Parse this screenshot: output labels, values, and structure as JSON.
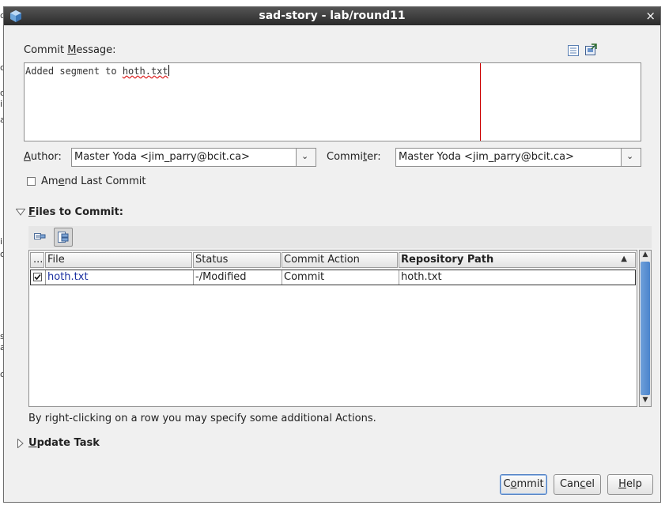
{
  "window": {
    "title": "sad-story - lab/round11",
    "close_label": "×"
  },
  "commit_message": {
    "label_before": "Commit ",
    "label_mnemonic": "M",
    "label_after": "essage:",
    "text_plain": "Added segment to ",
    "text_misspelled": "hoth.txt"
  },
  "author": {
    "label_mnemonic": "A",
    "label_after": "uthor:",
    "value": "Master Yoda <jim_parry@bcit.ca>"
  },
  "committer": {
    "label_before": "Commi",
    "label_mnemonic": "t",
    "label_after": "er:",
    "value": "Master Yoda <jim_parry@bcit.ca>"
  },
  "amend": {
    "label_before": "Am",
    "label_mnemonic": "e",
    "label_after": "nd Last Commit",
    "checked": false
  },
  "files_section": {
    "label_mnemonic": "F",
    "label_after": "iles to Commit:",
    "expanded": true
  },
  "table": {
    "columns": [
      "...",
      "File",
      "Status",
      "Commit Action",
      "Repository Path"
    ],
    "sort_indicator": "▲",
    "rows": [
      {
        "include": true,
        "file": "hoth.txt",
        "status": "-/Modified",
        "action": "Commit",
        "path": "hoth.txt"
      }
    ]
  },
  "hint_text": "By right-clicking on a row you may specify some additional Actions.",
  "update_task": {
    "label_mnemonic": "U",
    "label_after": "pdate Task",
    "expanded": false
  },
  "buttons": {
    "commit": {
      "before": "C",
      "mnemonic": "o",
      "after": "mmit"
    },
    "cancel": {
      "before": "Can",
      "mnemonic": "c",
      "after": "el"
    },
    "help": {
      "before": "",
      "mnemonic": "H",
      "after": "elp"
    }
  },
  "colors": {
    "accent": "#4a84cc",
    "file_link": "#1a2fa0",
    "margin_line": "#c00000"
  }
}
